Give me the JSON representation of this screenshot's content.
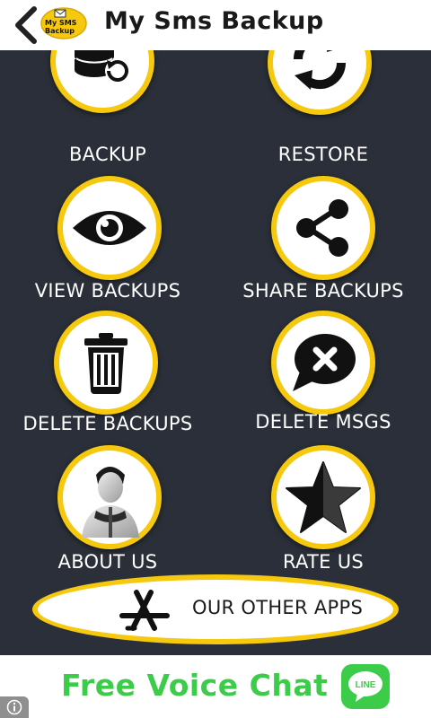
{
  "header": {
    "title": "My Sms Backup",
    "logo_text": "My SMS Backup"
  },
  "menu": {
    "backup": "BACKUP",
    "restore": "RESTORE",
    "view_backups": "VIEW BACKUPS",
    "share_backups": "SHARE BACKUPS",
    "delete_backups": "DELETE BACKUPS",
    "delete_msgs": "DELETE MSGS",
    "about_us": "ABOUT US",
    "rate_us": "RATE US",
    "other_apps": "OUR OTHER APPS"
  },
  "ad": {
    "text": "Free Voice Chat",
    "logo_text": "LINE"
  },
  "colors": {
    "panel_bg": "#2a2f39",
    "accent_yellow": "#f6c90e",
    "ad_green": "#3dcc4a"
  },
  "icons": [
    "back-arrow-icon",
    "database-restore-icon",
    "refresh-icon",
    "eye-icon",
    "share-icon",
    "trash-icon",
    "chat-x-icon",
    "person-icon",
    "star-icon",
    "app-store-icon",
    "info-icon"
  ]
}
